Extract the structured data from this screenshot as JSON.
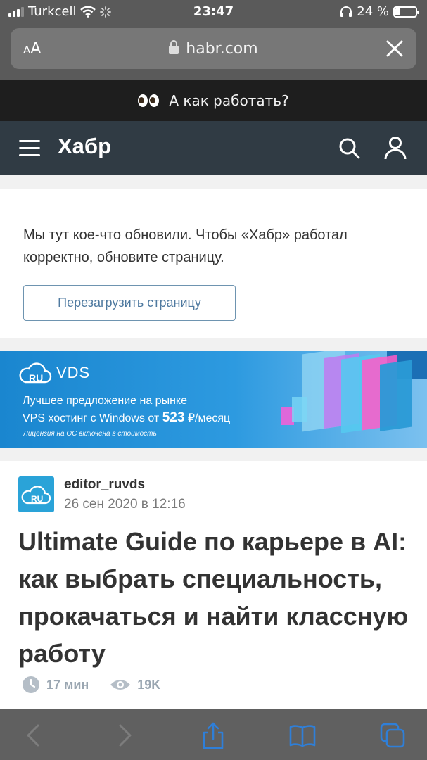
{
  "status_bar": {
    "carrier": "Turkcell",
    "time": "23:47",
    "battery_percent": "24 %",
    "battery_level": 0.24
  },
  "browser": {
    "text_size_label": "AA",
    "url": "habr.com"
  },
  "promo_bar": {
    "text": "А как работать?",
    "icon": "eyes-emoji"
  },
  "header": {
    "logo": "Хабр",
    "icons": [
      "menu-icon",
      "search-icon",
      "user-icon"
    ]
  },
  "notice": {
    "text": "Мы тут кое-что обновили. Чтобы «Хабр» работал корректно, обновите страницу.",
    "button": "Перезагрузить страницу"
  },
  "banner": {
    "logo_mark": "RU",
    "logo_text": "VDS",
    "line1": "Лучшее предложение на рынке",
    "line2_prefix": "VPS хостинг с Windows от",
    "price": "523",
    "line2_suffix": "₽/месяц",
    "note": "Лицензия на ОС включена в стоимость"
  },
  "post": {
    "avatar_label": "RU",
    "author": "editor_ruvds",
    "date": "26 сен 2020 в 12:16",
    "title": "Ultimate Guide по карьере в AI: как выбрать специальность, прокачаться и найти классную работу",
    "read_time": "17 мин",
    "views": "19K"
  },
  "toolbar": {
    "icons": [
      "back-icon",
      "forward-icon",
      "share-icon",
      "bookmarks-icon",
      "tabs-icon"
    ]
  },
  "colors": {
    "header_bg": "#303b44",
    "promo_bg": "#1e1e1e",
    "banner_blue": "#1a86cf",
    "button_border": "#6e94b0",
    "meta_gray": "#9aa6b1",
    "ios_blue": "#2f7fd8"
  }
}
